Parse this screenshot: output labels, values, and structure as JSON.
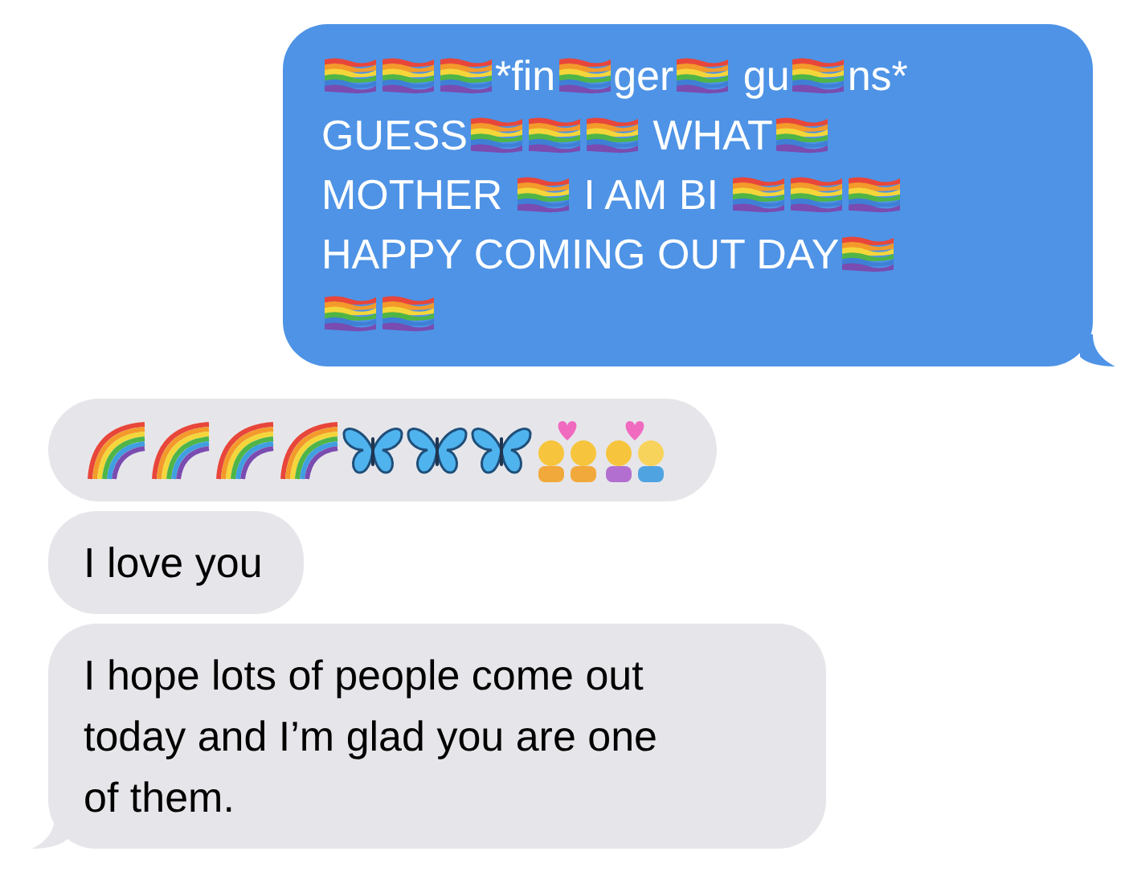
{
  "sent_message": {
    "lines": [
      [
        {
          "kind": "flag"
        },
        {
          "kind": "flag"
        },
        {
          "kind": "flag"
        },
        {
          "kind": "text",
          "text": "*fin"
        },
        {
          "kind": "flag"
        },
        {
          "kind": "text",
          "text": "ger"
        },
        {
          "kind": "flag"
        },
        {
          "kind": "text",
          "text": " gu"
        },
        {
          "kind": "flag"
        },
        {
          "kind": "text",
          "text": "ns*"
        }
      ],
      [
        {
          "kind": "text",
          "text": "GUESS"
        },
        {
          "kind": "flag"
        },
        {
          "kind": "flag"
        },
        {
          "kind": "flag"
        },
        {
          "kind": "text",
          "text": " WHAT"
        },
        {
          "kind": "flag"
        }
      ],
      [
        {
          "kind": "text",
          "text": "MOTHER "
        },
        {
          "kind": "flag"
        },
        {
          "kind": "text",
          "text": " I AM BI "
        },
        {
          "kind": "flag"
        },
        {
          "kind": "flag"
        },
        {
          "kind": "flag"
        }
      ],
      [
        {
          "kind": "text",
          "text": "HAPPY COMING OUT DAY"
        },
        {
          "kind": "flag"
        }
      ],
      [
        {
          "kind": "flag"
        },
        {
          "kind": "flag"
        }
      ]
    ]
  },
  "received_messages": [
    {
      "kind": "emoji",
      "tail": false,
      "parts": [
        {
          "kind": "rainbow"
        },
        {
          "kind": "rainbow"
        },
        {
          "kind": "rainbow"
        },
        {
          "kind": "rainbow"
        },
        {
          "kind": "butterfly"
        },
        {
          "kind": "butterfly"
        },
        {
          "kind": "butterfly"
        },
        {
          "kind": "couple_women"
        },
        {
          "kind": "couple_mixed"
        }
      ]
    },
    {
      "kind": "text",
      "tail": false,
      "text": "I love you"
    },
    {
      "kind": "text",
      "tail": true,
      "text": "I hope lots of people come out today and I’m glad you are one of them."
    }
  ]
}
